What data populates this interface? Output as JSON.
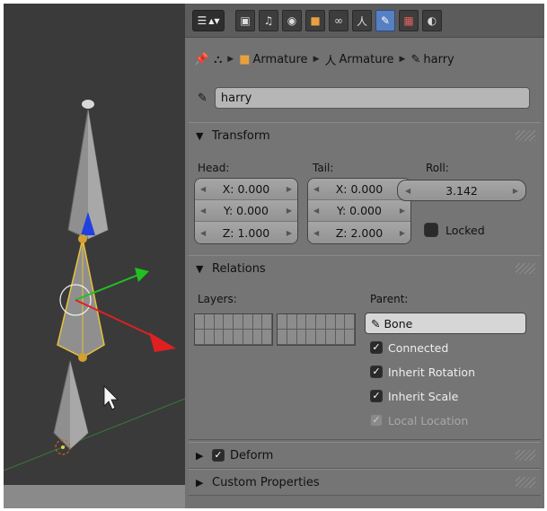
{
  "viewport": {
    "bg": "#3a3a3a",
    "bone_fill": "#8f8f8f",
    "selected_outline": "#e8c23a",
    "axis_x_color": "#e02020",
    "axis_y_color": "#20c020",
    "axis_z_color": "#2040e0",
    "floor_line_color": "#3a7a3a"
  },
  "header": {
    "editor_icon": "properties-editor-icon",
    "tabs": [
      {
        "icon": "render-icon",
        "active": false
      },
      {
        "icon": "render-layers-icon",
        "active": false
      },
      {
        "icon": "world-icon",
        "active": false
      },
      {
        "icon": "object-icon",
        "active": false
      },
      {
        "icon": "constraints-icon",
        "active": false
      },
      {
        "icon": "armature-data-icon",
        "active": false
      },
      {
        "icon": "bone-icon",
        "active": true
      },
      {
        "icon": "bone-constraints-icon",
        "active": false
      },
      {
        "icon": "material-icon",
        "active": false
      }
    ]
  },
  "breadcrumb": {
    "items": [
      "Armature",
      "Armature",
      "harry"
    ]
  },
  "bone_name": "harry",
  "transform": {
    "title": "Transform",
    "head_label": "Head:",
    "tail_label": "Tail:",
    "roll_label": "Roll:",
    "head": [
      "X: 0.000",
      "Y: 0.000",
      "Z: 1.000"
    ],
    "tail": [
      "X: 0.000",
      "Y: 0.000",
      "Z: 2.000"
    ],
    "roll": "3.142",
    "locked_label": "Locked",
    "locked": false
  },
  "relations": {
    "title": "Relations",
    "layers_label": "Layers:",
    "parent_label": "Parent:",
    "parent_value": "Bone",
    "checks": [
      {
        "label": "Connected",
        "checked": true,
        "enabled": true
      },
      {
        "label": "Inherit Rotation",
        "checked": true,
        "enabled": true
      },
      {
        "label": "Inherit Scale",
        "checked": true,
        "enabled": true
      },
      {
        "label": "Local Location",
        "checked": true,
        "enabled": false
      }
    ]
  },
  "deform": {
    "title": "Deform",
    "checked": true
  },
  "custom_props": {
    "title": "Custom Properties"
  }
}
